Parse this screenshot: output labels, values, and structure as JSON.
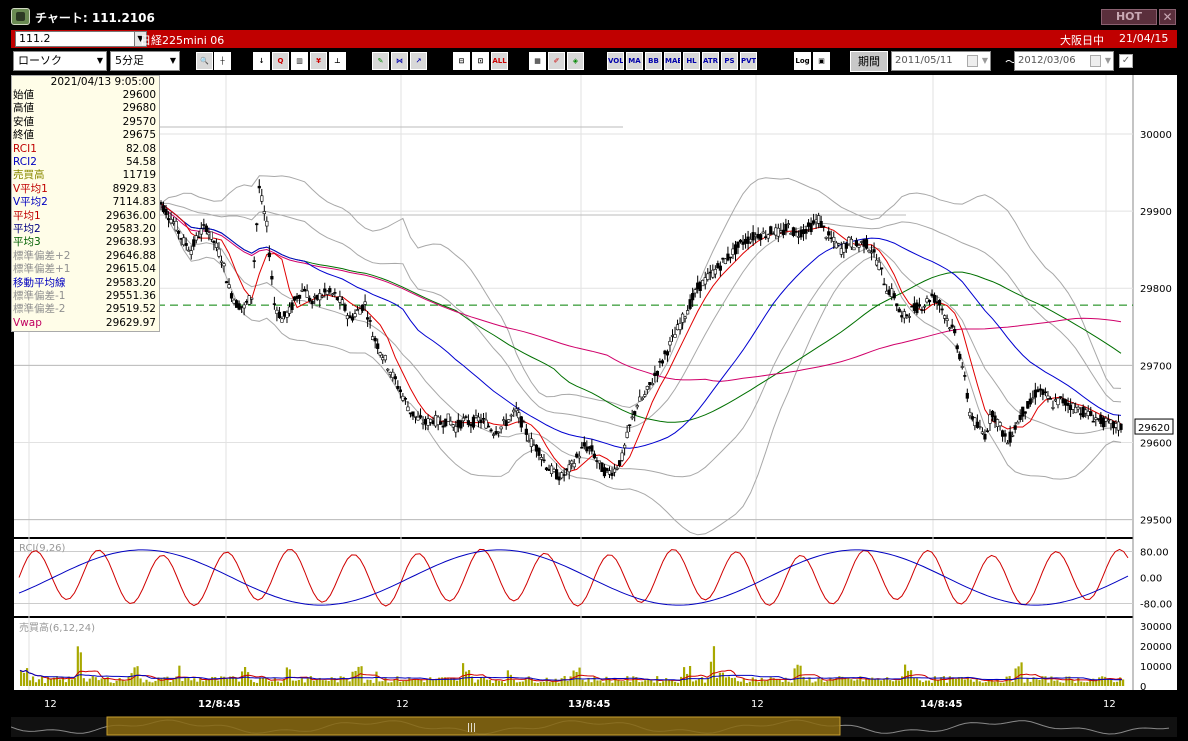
{
  "window": {
    "title": "チャート: 111.2106",
    "hot_label": "HOT",
    "close_label": "✕"
  },
  "instrument": {
    "code": "111.2",
    "name": "日経225mini 06",
    "session": "大阪日中",
    "date": "21/04/15"
  },
  "toolbar": {
    "chart_type": "ローソク",
    "interval": "5分足",
    "period_label": "期間",
    "date_from": "2011/05/11",
    "date_to": "2012/03/06",
    "tilde": "～",
    "buttons": [
      {
        "name": "zoom",
        "label": "🔍"
      },
      {
        "name": "crosshair",
        "label": "┼"
      },
      {
        "name": "tool-a",
        "label": "↓"
      },
      {
        "name": "tool-b",
        "label": "Q"
      },
      {
        "name": "tool-c",
        "label": "▥"
      },
      {
        "name": "tool-d",
        "label": "¥"
      },
      {
        "name": "tool-e",
        "label": "⊥"
      },
      {
        "name": "tool-f",
        "label": "✎"
      },
      {
        "name": "tool-g",
        "label": "⋈"
      },
      {
        "name": "tool-h",
        "label": "↗"
      },
      {
        "name": "tool-i",
        "label": "⊟"
      },
      {
        "name": "tool-j",
        "label": "⊡"
      },
      {
        "name": "all",
        "label": "ALL"
      },
      {
        "name": "tool-k",
        "label": "▦"
      },
      {
        "name": "tool-l",
        "label": "✐"
      },
      {
        "name": "tool-m",
        "label": "◈"
      },
      {
        "name": "vol",
        "label": "VOL"
      },
      {
        "name": "ma",
        "label": "MA"
      },
      {
        "name": "bb",
        "label": "BB"
      },
      {
        "name": "mae",
        "label": "MAE"
      },
      {
        "name": "hl",
        "label": "HL"
      },
      {
        "name": "atr",
        "label": "ATR"
      },
      {
        "name": "psra",
        "label": "PS RA"
      },
      {
        "name": "pvt",
        "label": "PVT"
      },
      {
        "name": "log",
        "label": "Log"
      },
      {
        "name": "tool-n",
        "label": "▣"
      }
    ]
  },
  "info_panel": {
    "datetime": "2021/04/13 9:05:00",
    "rows": [
      {
        "label": "始値",
        "value": "29600",
        "color": "#000000"
      },
      {
        "label": "高値",
        "value": "29680",
        "color": "#000000"
      },
      {
        "label": "安値",
        "value": "29570",
        "color": "#000000"
      },
      {
        "label": "終値",
        "value": "29675",
        "color": "#000000"
      },
      {
        "label": "RCI1",
        "value": "82.08",
        "color": "#c00000"
      },
      {
        "label": "RCI2",
        "value": "54.58",
        "color": "#0000c0"
      },
      {
        "label": "売買高",
        "value": "11719",
        "color": "#8a8a00"
      },
      {
        "label": "V平均1",
        "value": "8929.83",
        "color": "#c00000"
      },
      {
        "label": "V平均2",
        "value": "7114.83",
        "color": "#0000c0"
      },
      {
        "label": "平均1",
        "value": "29636.00",
        "color": "#c00000"
      },
      {
        "label": "平均2",
        "value": "29583.20",
        "color": "#000080"
      },
      {
        "label": "平均3",
        "value": "29638.93",
        "color": "#006000"
      },
      {
        "label": "標準偏差+2",
        "value": "29646.88",
        "color": "#909090"
      },
      {
        "label": "標準偏差+1",
        "value": "29615.04",
        "color": "#909090"
      },
      {
        "label": "移動平均線",
        "value": "29583.20",
        "color": "#0000c0"
      },
      {
        "label": "標準偏差-1",
        "value": "29551.36",
        "color": "#909090"
      },
      {
        "label": "標準偏差-2",
        "value": "29519.52",
        "color": "#909090"
      },
      {
        "label": "Vwap",
        "value": "29629.97",
        "color": "#c00060"
      }
    ]
  },
  "colors": {
    "background": "#ffffff",
    "up": "#ffffff",
    "down": "#000000",
    "ma1": "#e00000",
    "ma2": "#0000d0",
    "ma3": "#007000",
    "vwap": "#d0006a",
    "band": "#a8a8a8",
    "volume": "#a8a800",
    "dashed": "#008000"
  },
  "chart_data": {
    "type": "candlestick",
    "price_axis": {
      "labels": [
        "30000",
        "29900",
        "29800",
        "29700",
        "29600",
        "29500"
      ],
      "ylim": [
        29480,
        30070
      ],
      "current_price": "29620",
      "reference_level": 29778
    },
    "x_labels": [
      "12",
      "12/8:45",
      "12",
      "13/8:45",
      "12",
      "14/8:45",
      "12"
    ],
    "closes": [
      29910,
      29895,
      29880,
      29860,
      29850,
      29870,
      29880,
      29860,
      29840,
      29800,
      29780,
      29775,
      29790,
      29930,
      29880,
      29780,
      29760,
      29770,
      29790,
      29800,
      29780,
      29790,
      29795,
      29790,
      29780,
      29760,
      29770,
      29780,
      29740,
      29720,
      29700,
      29680,
      29660,
      29640,
      29630,
      29625,
      29630,
      29625,
      29630,
      29620,
      29628,
      29625,
      29630,
      29625,
      29615,
      29620,
      29630,
      29640,
      29620,
      29600,
      29590,
      29570,
      29560,
      29555,
      29565,
      29580,
      29595,
      29590,
      29570,
      29560,
      29565,
      29580,
      29620,
      29650,
      29660,
      29680,
      29700,
      29720,
      29740,
      29760,
      29780,
      29800,
      29810,
      29820,
      29830,
      29840,
      29850,
      29860,
      29865,
      29870,
      29870,
      29875,
      29870,
      29880,
      29870,
      29875,
      29880,
      29890,
      29870,
      29860,
      29850,
      29860,
      29855,
      29860,
      29850,
      29830,
      29800,
      29790,
      29760,
      29770,
      29775,
      29780,
      29790,
      29780,
      29760,
      29740,
      29700,
      29640,
      29620,
      29610,
      29640,
      29620,
      29600,
      29620,
      29640,
      29650,
      29670,
      29660,
      29650,
      29655,
      29650,
      29645,
      29640,
      29635,
      29630,
      29625,
      29622,
      29620
    ],
    "series": [
      {
        "name": "平均1",
        "period_note": "short"
      },
      {
        "name": "平均2",
        "period_note": "mid"
      },
      {
        "name": "平均3",
        "period_note": "long"
      }
    ],
    "rci": {
      "title": "RCI(9,26)",
      "labels": [
        "80.00",
        "0.00",
        "-80.00"
      ],
      "ylim": [
        -100,
        100
      ]
    },
    "volume": {
      "title": "売買高(6,12,24)",
      "labels": [
        "30000",
        "20000",
        "10000",
        "0"
      ],
      "ylim": [
        0,
        32000
      ]
    }
  }
}
